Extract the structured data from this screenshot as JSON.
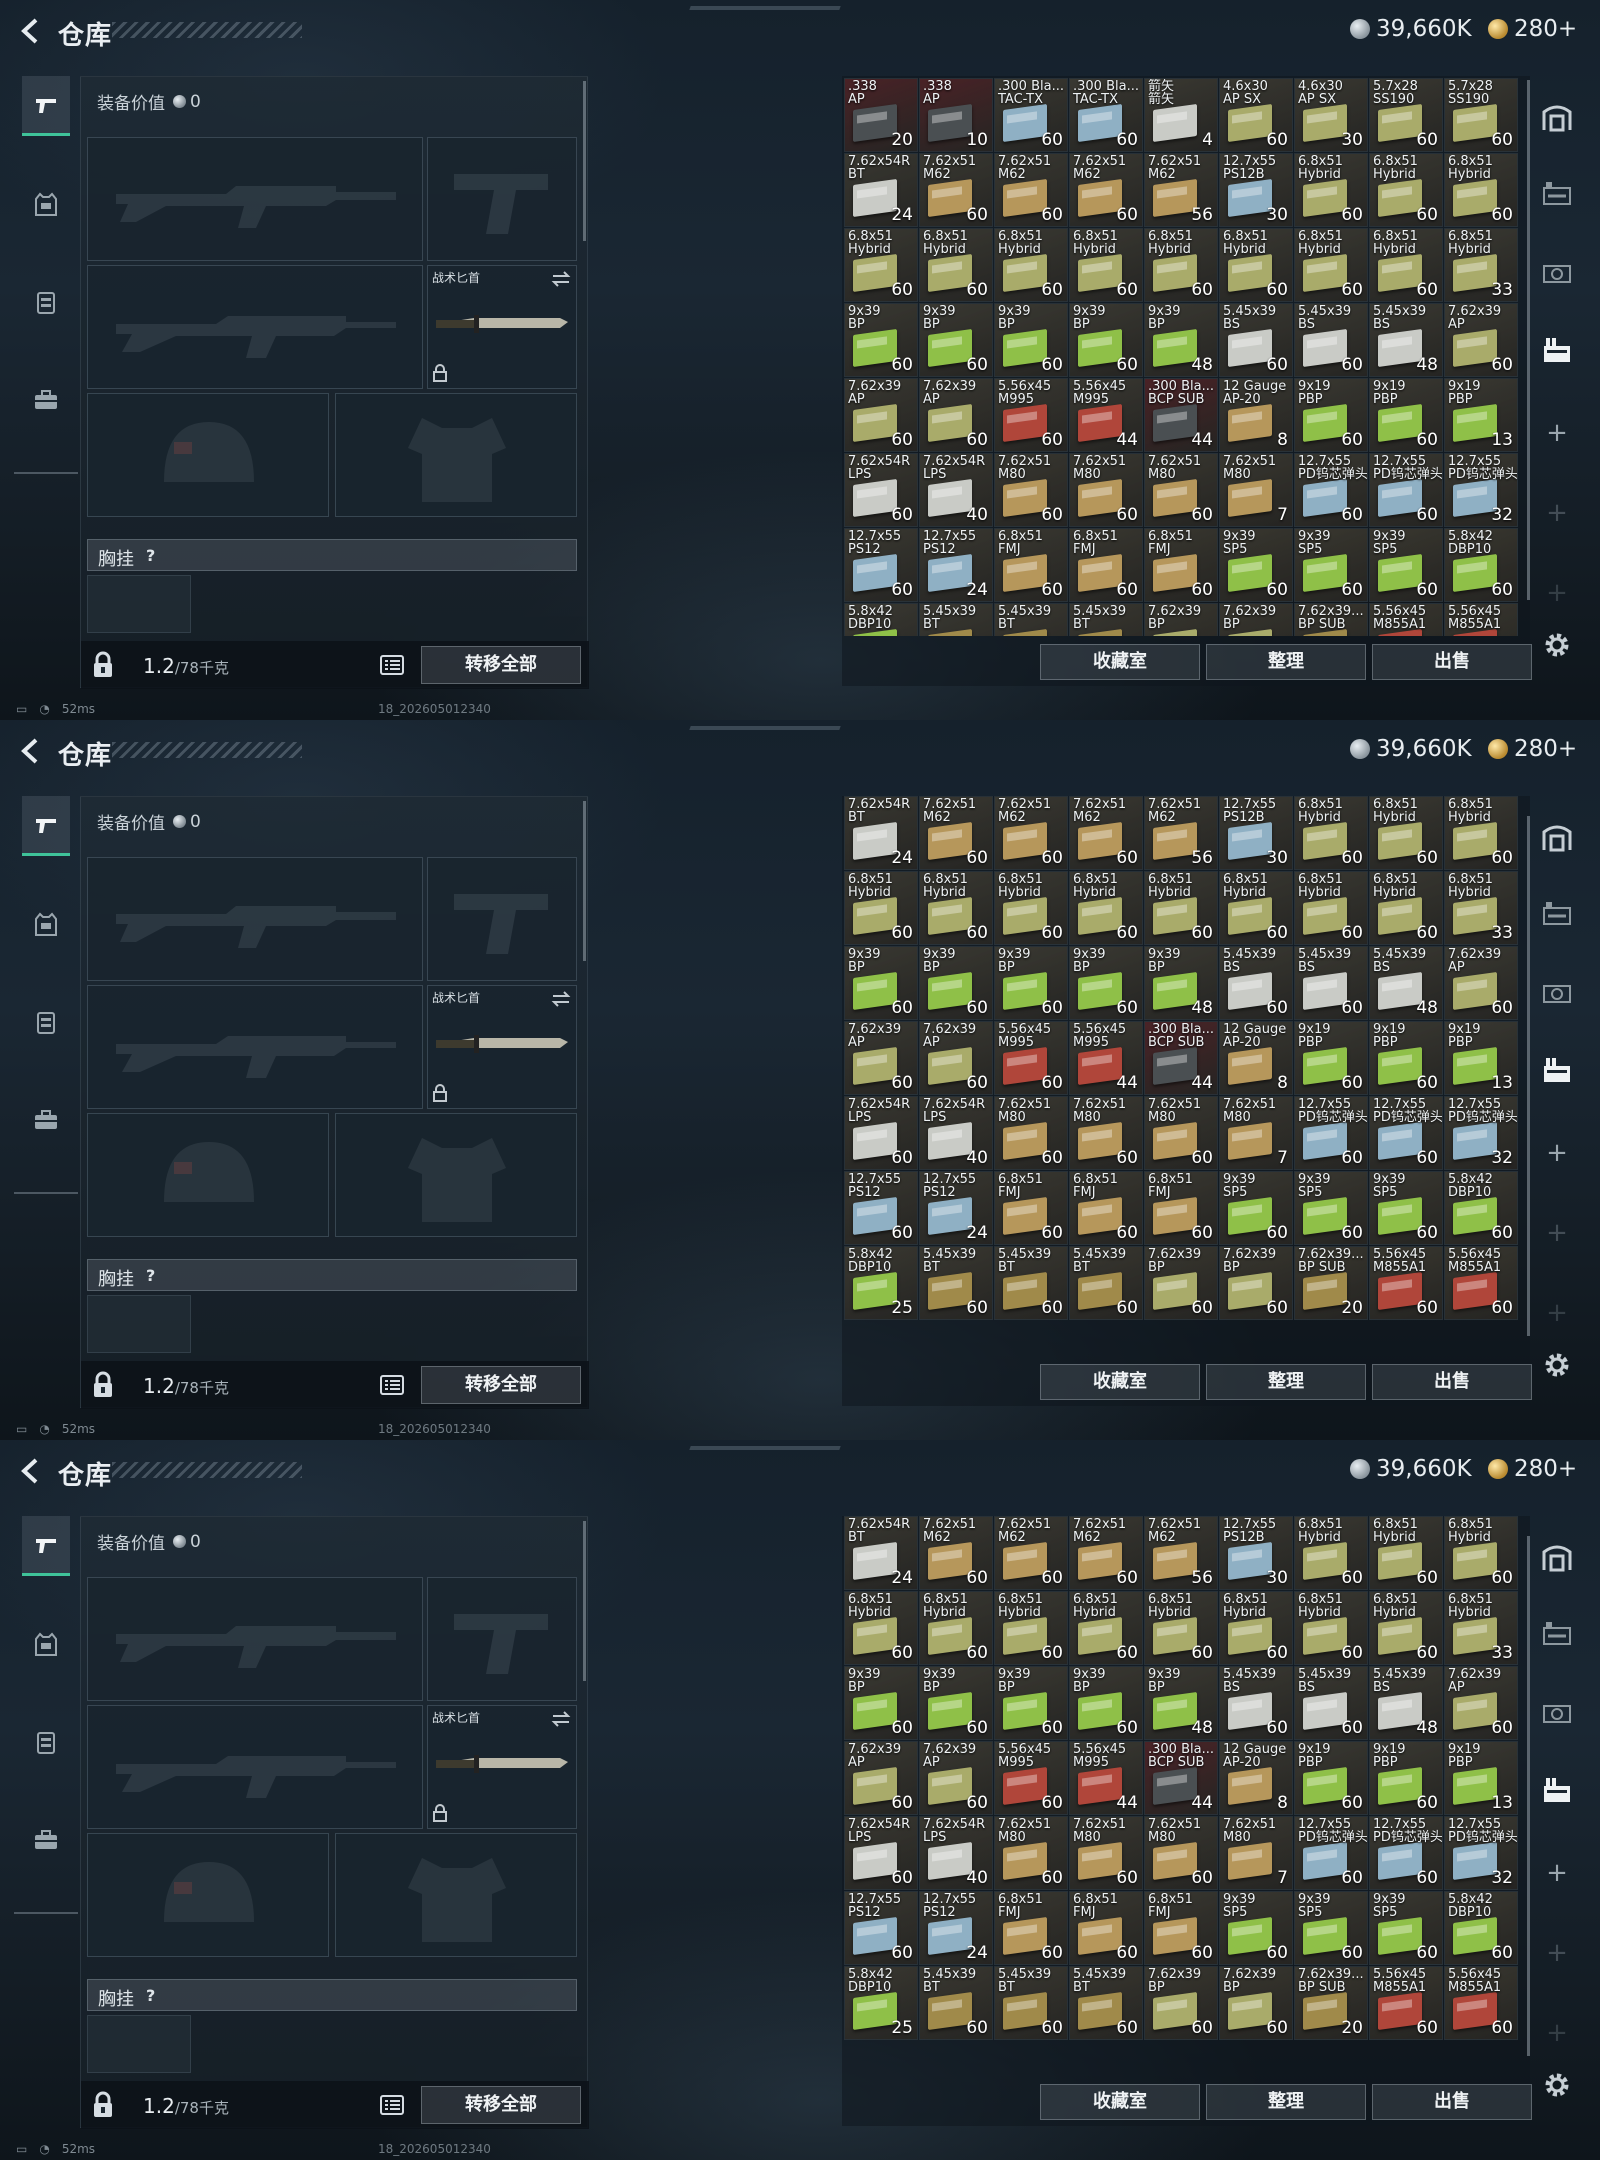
{
  "screens": [
    {
      "id": "top",
      "scroll_rows": 0
    },
    {
      "id": "middle",
      "scroll_rows": 1
    },
    {
      "id": "bottom",
      "scroll_rows": 1
    }
  ],
  "header": {
    "title": "仓库",
    "silver_coins": "39,660K",
    "gold_coins": "280+"
  },
  "equipment": {
    "value_label": "装备价值",
    "value": "0",
    "knife_label": "战术匕首",
    "vest_label": "胸挂",
    "vest_help": "?",
    "weight": "1.2",
    "weight_max": "/78千克",
    "transfer_all": "转移全部"
  },
  "storage": {
    "collection_button": "收藏室",
    "sort_button": "整理",
    "sell_button": "出售",
    "colors": {
      "tan": "#b6975b",
      "white": "#c9cbc6",
      "green": "#8fc048",
      "blue": "#8fb0c4",
      "olive": "#a9ab6a",
      "red": "#b0463a",
      "dark": "#4a4f52",
      "brass": "#a08a4a"
    },
    "rows": [
      [
        {
          "name": ".338\nAP",
          "count": "20",
          "color": "dark"
        },
        {
          "name": ".338\nAP",
          "count": "10",
          "color": "dark"
        },
        {
          "name": ".300 Bla...\nTAC-TX",
          "count": "60",
          "color": "blue"
        },
        {
          "name": ".300 Bla...\nTAC-TX",
          "count": "60",
          "color": "blue"
        },
        {
          "name": "箭矢\n箭矢",
          "count": "4",
          "color": "white"
        },
        {
          "name": "4.6x30\nAP SX",
          "count": "60",
          "color": "olive"
        },
        {
          "name": "4.6x30\nAP SX",
          "count": "30",
          "color": "olive"
        },
        {
          "name": "5.7x28\nSS190",
          "count": "60",
          "color": "olive"
        },
        {
          "name": "5.7x28\nSS190",
          "count": "60",
          "color": "olive"
        }
      ],
      [
        {
          "name": "7.62x54R\nBT",
          "count": "24",
          "color": "white"
        },
        {
          "name": "7.62x51\nM62",
          "count": "60",
          "color": "tan"
        },
        {
          "name": "7.62x51\nM62",
          "count": "60",
          "color": "tan"
        },
        {
          "name": "7.62x51\nM62",
          "count": "60",
          "color": "tan"
        },
        {
          "name": "7.62x51\nM62",
          "count": "56",
          "color": "tan"
        },
        {
          "name": "12.7x55\nPS12B",
          "count": "30",
          "color": "blue"
        },
        {
          "name": "6.8x51\nHybrid",
          "count": "60",
          "color": "olive"
        },
        {
          "name": "6.8x51\nHybrid",
          "count": "60",
          "color": "olive"
        },
        {
          "name": "6.8x51\nHybrid",
          "count": "60",
          "color": "olive"
        }
      ],
      [
        {
          "name": "6.8x51\nHybrid",
          "count": "60",
          "color": "olive"
        },
        {
          "name": "6.8x51\nHybrid",
          "count": "60",
          "color": "olive"
        },
        {
          "name": "6.8x51\nHybrid",
          "count": "60",
          "color": "olive"
        },
        {
          "name": "6.8x51\nHybrid",
          "count": "60",
          "color": "olive"
        },
        {
          "name": "6.8x51\nHybrid",
          "count": "60",
          "color": "olive"
        },
        {
          "name": "6.8x51\nHybrid",
          "count": "60",
          "color": "olive"
        },
        {
          "name": "6.8x51\nHybrid",
          "count": "60",
          "color": "olive"
        },
        {
          "name": "6.8x51\nHybrid",
          "count": "60",
          "color": "olive"
        },
        {
          "name": "6.8x51\nHybrid",
          "count": "33",
          "color": "olive"
        }
      ],
      [
        {
          "name": "9x39\nBP",
          "count": "60",
          "color": "green"
        },
        {
          "name": "9x39\nBP",
          "count": "60",
          "color": "green"
        },
        {
          "name": "9x39\nBP",
          "count": "60",
          "color": "green"
        },
        {
          "name": "9x39\nBP",
          "count": "60",
          "color": "green"
        },
        {
          "name": "9x39\nBP",
          "count": "48",
          "color": "green"
        },
        {
          "name": "5.45x39\nBS",
          "count": "60",
          "color": "white"
        },
        {
          "name": "5.45x39\nBS",
          "count": "60",
          "color": "white"
        },
        {
          "name": "5.45x39\nBS",
          "count": "48",
          "color": "white"
        },
        {
          "name": "7.62x39\nAP",
          "count": "60",
          "color": "olive"
        }
      ],
      [
        {
          "name": "7.62x39\nAP",
          "count": "60",
          "color": "olive"
        },
        {
          "name": "7.62x39\nAP",
          "count": "60",
          "color": "olive"
        },
        {
          "name": "5.56x45\nM995",
          "count": "60",
          "color": "red"
        },
        {
          "name": "5.56x45\nM995",
          "count": "44",
          "color": "red"
        },
        {
          "name": ".300 Bla...\nBCP SUB",
          "count": "44",
          "color": "dark"
        },
        {
          "name": "12 Gauge\nAP-20",
          "count": "8",
          "color": "tan"
        },
        {
          "name": "9x19\nPBP",
          "count": "60",
          "color": "green"
        },
        {
          "name": "9x19\nPBP",
          "count": "60",
          "color": "green"
        },
        {
          "name": "9x19\nPBP",
          "count": "13",
          "color": "green"
        }
      ],
      [
        {
          "name": "7.62x54R\nLPS",
          "count": "60",
          "color": "white"
        },
        {
          "name": "7.62x54R\nLPS",
          "count": "40",
          "color": "white"
        },
        {
          "name": "7.62x51\nM80",
          "count": "60",
          "color": "tan"
        },
        {
          "name": "7.62x51\nM80",
          "count": "60",
          "color": "tan"
        },
        {
          "name": "7.62x51\nM80",
          "count": "60",
          "color": "tan"
        },
        {
          "name": "7.62x51\nM80",
          "count": "7",
          "color": "tan"
        },
        {
          "name": "12.7x55\nPD钨芯弹头",
          "count": "60",
          "color": "blue"
        },
        {
          "name": "12.7x55\nPD钨芯弹头",
          "count": "60",
          "color": "blue"
        },
        {
          "name": "12.7x55\nPD钨芯弹头",
          "count": "32",
          "color": "blue"
        }
      ],
      [
        {
          "name": "12.7x55\nPS12",
          "count": "60",
          "color": "blue"
        },
        {
          "name": "12.7x55\nPS12",
          "count": "24",
          "color": "blue"
        },
        {
          "name": "6.8x51\nFMJ",
          "count": "60",
          "color": "tan"
        },
        {
          "name": "6.8x51\nFMJ",
          "count": "60",
          "color": "tan"
        },
        {
          "name": "6.8x51\nFMJ",
          "count": "60",
          "color": "tan"
        },
        {
          "name": "9x39\nSP5",
          "count": "60",
          "color": "green"
        },
        {
          "name": "9x39\nSP5",
          "count": "60",
          "color": "green"
        },
        {
          "name": "9x39\nSP5",
          "count": "60",
          "color": "green"
        },
        {
          "name": "5.8x42\nDBP10",
          "count": "60",
          "color": "green"
        }
      ],
      [
        {
          "name": "5.8x42\nDBP10",
          "count": "25",
          "color": "green"
        },
        {
          "name": "5.45x39\nBT",
          "count": "60",
          "color": "brass"
        },
        {
          "name": "5.45x39\nBT",
          "count": "60",
          "color": "brass"
        },
        {
          "name": "5.45x39\nBT",
          "count": "60",
          "color": "brass"
        },
        {
          "name": "7.62x39\nBP",
          "count": "60",
          "color": "olive"
        },
        {
          "name": "7.62x39\nBP",
          "count": "60",
          "color": "olive"
        },
        {
          "name": "7.62x39...\nBP SUB",
          "count": "20",
          "color": "brass"
        },
        {
          "name": "5.56x45\nM855A1",
          "count": "60",
          "color": "red"
        },
        {
          "name": "5.56x45\nM855A1",
          "count": "60",
          "color": "red"
        }
      ]
    ]
  },
  "status": {
    "ping": "52ms",
    "build": "18_202605012340"
  }
}
